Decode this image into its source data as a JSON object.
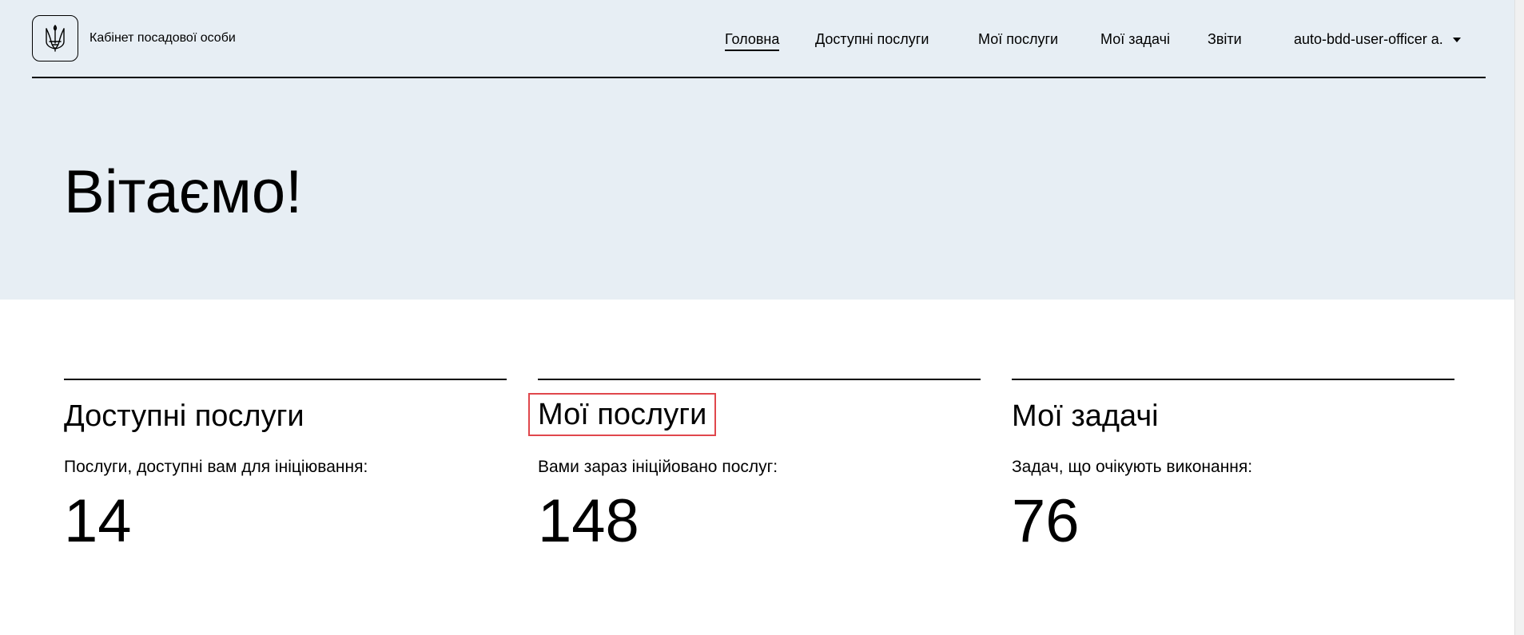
{
  "header": {
    "brand_title": "Кабінет посадової особи",
    "nav": [
      {
        "label": "Головна",
        "active": true
      },
      {
        "label": "Доступні послуги",
        "active": false
      },
      {
        "label": "Мої послуги",
        "active": false
      },
      {
        "label": "Мої задачі",
        "active": false
      },
      {
        "label": "Звіти",
        "active": false
      }
    ],
    "user_label": "auto-bdd-user-officer a."
  },
  "hero": {
    "title": "Вітаємо!"
  },
  "cards": [
    {
      "title": "Доступні послуги",
      "description": "Послуги, доступні вам для ініціювання:",
      "count": "14"
    },
    {
      "title": "Мої послуги",
      "description": "Вами зараз ініційовано послуг:",
      "count": "148",
      "highlight_color": "#e0474c"
    },
    {
      "title": "Мої задачі",
      "description": "Задач, що очікують виконання:",
      "count": "76"
    }
  ],
  "colors": {
    "hero_background": "#e7eef4",
    "text": "#000000",
    "highlight": "#e0474c"
  },
  "icons": {
    "logo": "trident-icon",
    "user_menu": "caret-down-icon"
  }
}
